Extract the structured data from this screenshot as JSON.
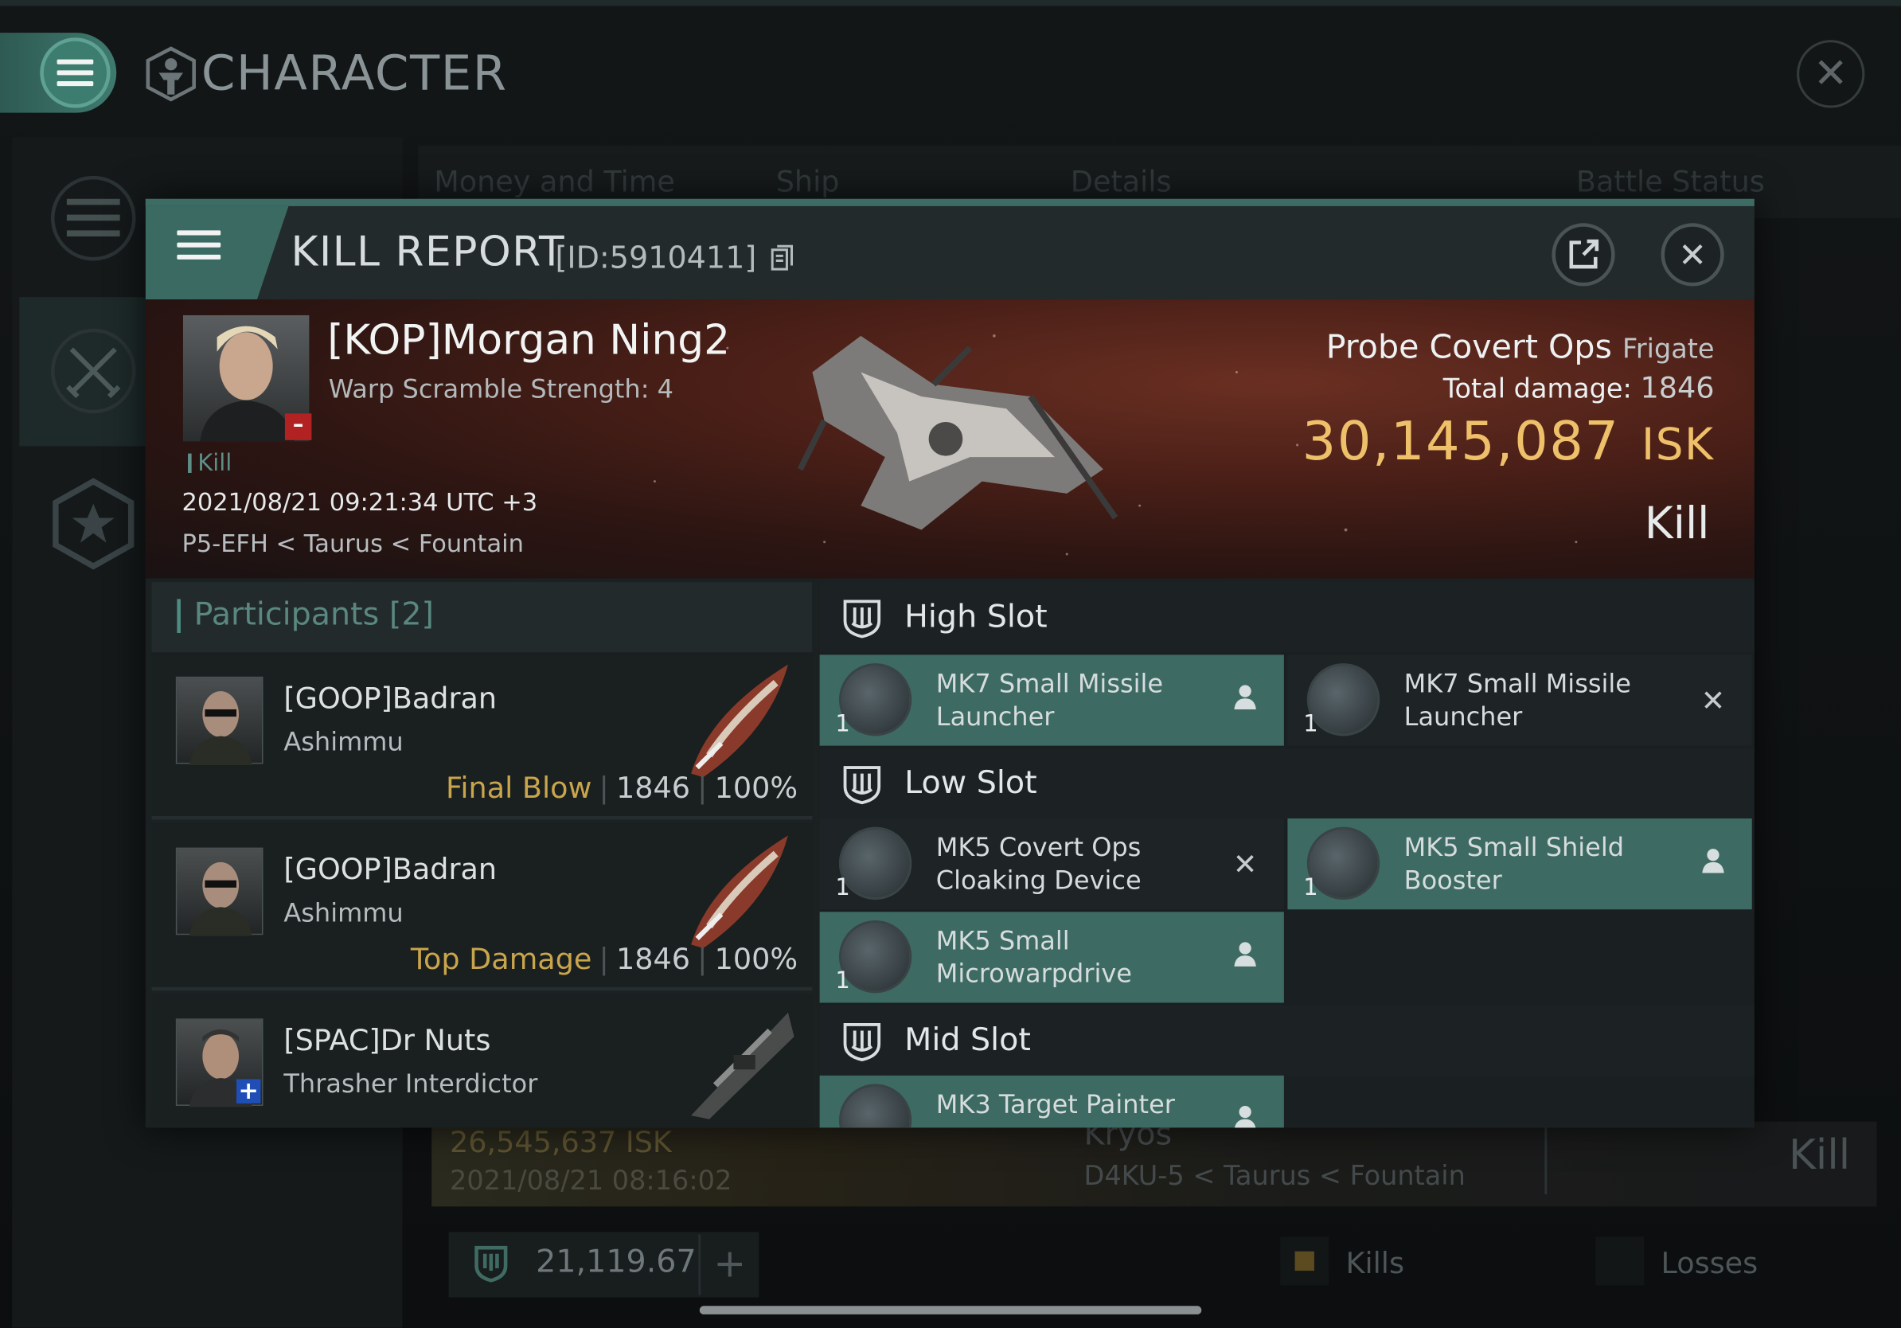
{
  "window": {
    "title": "CHARACTER"
  },
  "background": {
    "tabs": [
      "Money and Time",
      "Ship",
      "Details",
      "Battle Status"
    ],
    "row": {
      "isk": "26,545,637  ISK",
      "date": "2021/08/21  08:16:02",
      "ship": "Kryos",
      "location": "D4KU-5 < Taurus < Fountain",
      "result": "Kill"
    },
    "balance": "21,119.67",
    "legend": [
      "Kills",
      "Losses"
    ]
  },
  "report": {
    "title": "KILL REPORT",
    "id": "[ID:5910411]",
    "victim": {
      "name": "[KOP]Morgan Ning2",
      "warp": "Warp Scramble Strength: 4",
      "tag": "Kill",
      "timestamp": "2021/08/21 09:21:34 UTC +3",
      "location": "P5-EFH < Taurus < Fountain"
    },
    "ship": {
      "name": "Probe Covert Ops",
      "class": "Frigate"
    },
    "damage_label": "Total damage:",
    "damage_value": "1846",
    "value": "30,145,087",
    "value_unit": "ISK",
    "result": "Kill",
    "participants_title": "Participants",
    "participants_count": "[2]",
    "participants": [
      {
        "name": "[GOOP]Badran",
        "ship": "Ashimmu",
        "label": "Final Blow",
        "damage": "1846",
        "pct": "100%"
      },
      {
        "name": "[GOOP]Badran",
        "ship": "Ashimmu",
        "label": "Top Damage",
        "damage": "1846",
        "pct": "100%"
      },
      {
        "name": "[SPAC]Dr Nuts",
        "ship": "Thrasher Interdictor"
      }
    ],
    "slots": {
      "high": {
        "title": "High Slot",
        "mods": [
          {
            "qty": "1",
            "name1": "MK7 Small Missile",
            "name2": "Launcher"
          },
          {
            "qty": "1",
            "name1": "MK7 Small Missile",
            "name2": "Launcher"
          }
        ]
      },
      "low": {
        "title": "Low Slot",
        "mods": [
          {
            "qty": "1",
            "name1": "MK5 Covert Ops",
            "name2": "Cloaking Device"
          },
          {
            "qty": "1",
            "name1": "MK5 Small Shield",
            "name2": "Booster"
          },
          {
            "qty": "1",
            "name1": "MK5 Small",
            "name2": "Microwarpdrive"
          }
        ]
      },
      "mid": {
        "title": "Mid Slot",
        "mods": [
          {
            "qty": "1",
            "name1": "MK3 Target Painter",
            "name2": ""
          }
        ]
      }
    },
    "marks": {
      "fitted": "person-icon",
      "destroyed": "x-icon"
    },
    "colors": {
      "accent": "#3d6b63",
      "value": "#efc06a",
      "final_blow": "#c9a54c"
    }
  }
}
